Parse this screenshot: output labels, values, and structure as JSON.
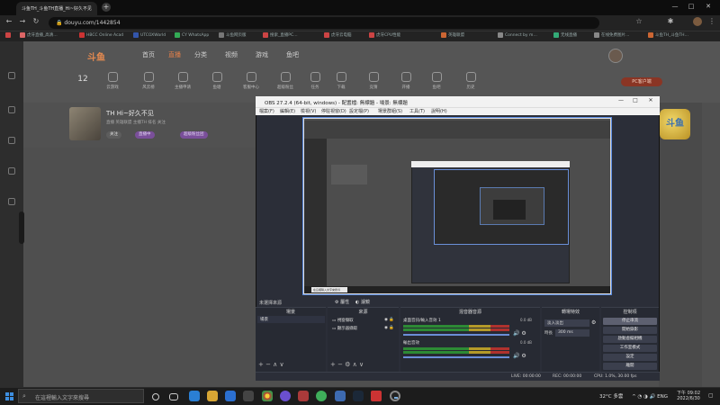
{
  "browser": {
    "tab_active": "斗鱼TH_斗鱼TH直播_Hi~好久不见",
    "url": "douyu.com/1442854",
    "new_tab": "+",
    "window_controls": [
      "—",
      "□",
      "✕"
    ],
    "bookmarks": [
      "虎牙直播_高清…",
      "HBCC Online Acad",
      "UTCOXWorld",
      "CY WhatsApp",
      "斗鱼网页版",
      "搜索_直播PC…",
      "虎牙云电脑",
      "虎牙CPU性能",
      "英雄联盟",
      "Connect by m…",
      "无线直播",
      "在线免费图片…",
      "斗鱼TH_斗鱼TH…"
    ]
  },
  "site": {
    "logo": "斗鱼",
    "nav": [
      "首页",
      "直播",
      "分类",
      "视频",
      "游戏",
      "鱼吧"
    ],
    "nav_active_index": 1,
    "icon_bar": [
      "云游戏",
      "风云榜",
      "主播申请",
      "鱼塘",
      "客服中心",
      "超级粉丝",
      "任务",
      "下载",
      "竞猜",
      "开播",
      "鱼吧",
      "历史"
    ],
    "counter": "12",
    "pc_client": "PC客户端",
    "streamer": {
      "title": "TH  Hi~好久不见",
      "meta": "直播  英雄联盟  主播TH  排名  关注",
      "tags": [
        "关注",
        "直播中",
        "超级粉丝团"
      ]
    },
    "mascot": "斗鱼"
  },
  "obs": {
    "title": "OBS 27.2.4 (64-bit, windows) - 配置檔: 無標題 - 場景: 無標題",
    "menu": [
      "檔案(F)",
      "編輯(E)",
      "檢視(V)",
      "停駐視窗(D)",
      "設定檔(P)",
      "場景群組(S)",
      "工具(T)",
      "說明(H)"
    ],
    "no_source_label": "未選擇來源",
    "properties_button": "屬性",
    "filters_button": "濾鏡",
    "docks": {
      "scenes": {
        "title": "場景",
        "items": [
          "場景"
        ]
      },
      "sources": {
        "title": "來源",
        "items": [
          "視窗擷取",
          "顯示器擷取"
        ]
      },
      "mixer": {
        "title": "混音器音源",
        "channels": [
          {
            "name": "桌面音訊/輸入音效 1",
            "db": "0.0 dB"
          },
          {
            "name": "輸出音效",
            "db": "0.0 dB"
          }
        ]
      },
      "transitions": {
        "title": "轉場特效",
        "type": "淡入淡出",
        "duration_label": "時長",
        "duration": "300 ms"
      },
      "controls": {
        "title": "控制項",
        "buttons": [
          "停止串流",
          "開始錄影",
          "啟動虛擬相機",
          "工作室模式",
          "設定",
          "離開"
        ]
      }
    },
    "status": {
      "live": "LIVE: 00:00:00",
      "rec": "REC: 00:00:00",
      "cpu": "CPU: 1.0%, 30.00 fps"
    }
  },
  "taskbar": {
    "search_placeholder": "在這裡輸入文字來搜尋",
    "weather": "32°C  多雲",
    "lang": "ENG",
    "time": "下午 09:02",
    "date": "2022/6/30"
  },
  "colors": {
    "accent_orange": "#e5804a",
    "obs_bg": "#2b2e38",
    "preview_border": "#5a8be0",
    "taskbar": "#1c1c1c"
  }
}
